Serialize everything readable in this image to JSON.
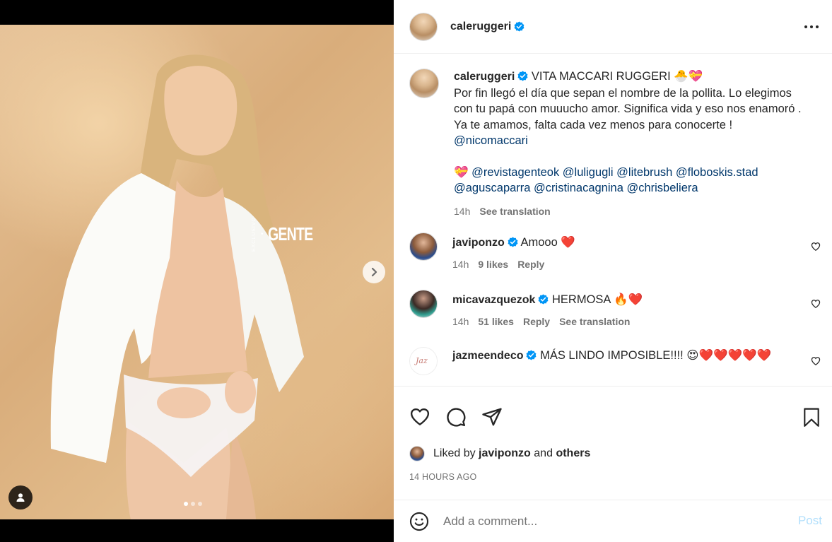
{
  "post": {
    "author": "caleruggeri",
    "watermark": {
      "main": "GENTE",
      "side": "EXCLUSIVO"
    },
    "carousel": {
      "total": 3,
      "current": 1
    }
  },
  "caption": {
    "author": "caleruggeri",
    "title": "VITA MACCARI RUGGERI",
    "title_emoji": "🐣💝",
    "lines": [
      "Por fin llegó el día que sepan el nombre de la pollita. Lo elegimos con tu papá con muuucho amor. Significa vida y eso nos enamoró .",
      "Ya te amamos, falta cada vez menos para conocerte !"
    ],
    "mention_main": "@nicomaccari",
    "credits_emoji": "💝",
    "credits": "@revistagenteok @luligugli @litebrush @floboskis.stad @aguscaparra @cristinacagnina @chrisbeliera",
    "time": "14h",
    "see_translation": "See translation"
  },
  "comments": [
    {
      "user": "javiponzo",
      "text": "Amooo ❤️",
      "time": "14h",
      "likes": "9 likes",
      "reply": "Reply",
      "translation": ""
    },
    {
      "user": "micavazquezok",
      "text": "HERMOSA 🔥❤️",
      "time": "14h",
      "likes": "51 likes",
      "reply": "Reply",
      "translation": "See translation"
    },
    {
      "user": "jazmeendeco",
      "text": "MÁS LINDO IMPOSIBLE!!!! 😍❤️❤️❤️❤️❤️",
      "avatar_text": "Jaz"
    }
  ],
  "likes": {
    "prefix": "Liked by",
    "user": "javiponzo",
    "and": "and",
    "others": "others"
  },
  "timestamp": "14 HOURS AGO",
  "add_comment": {
    "placeholder": "Add a comment...",
    "post_label": "Post"
  },
  "colors": {
    "verified": "#0095f6",
    "mention": "#00376b",
    "post_disabled": "#b2dffc",
    "muted": "#737373"
  }
}
